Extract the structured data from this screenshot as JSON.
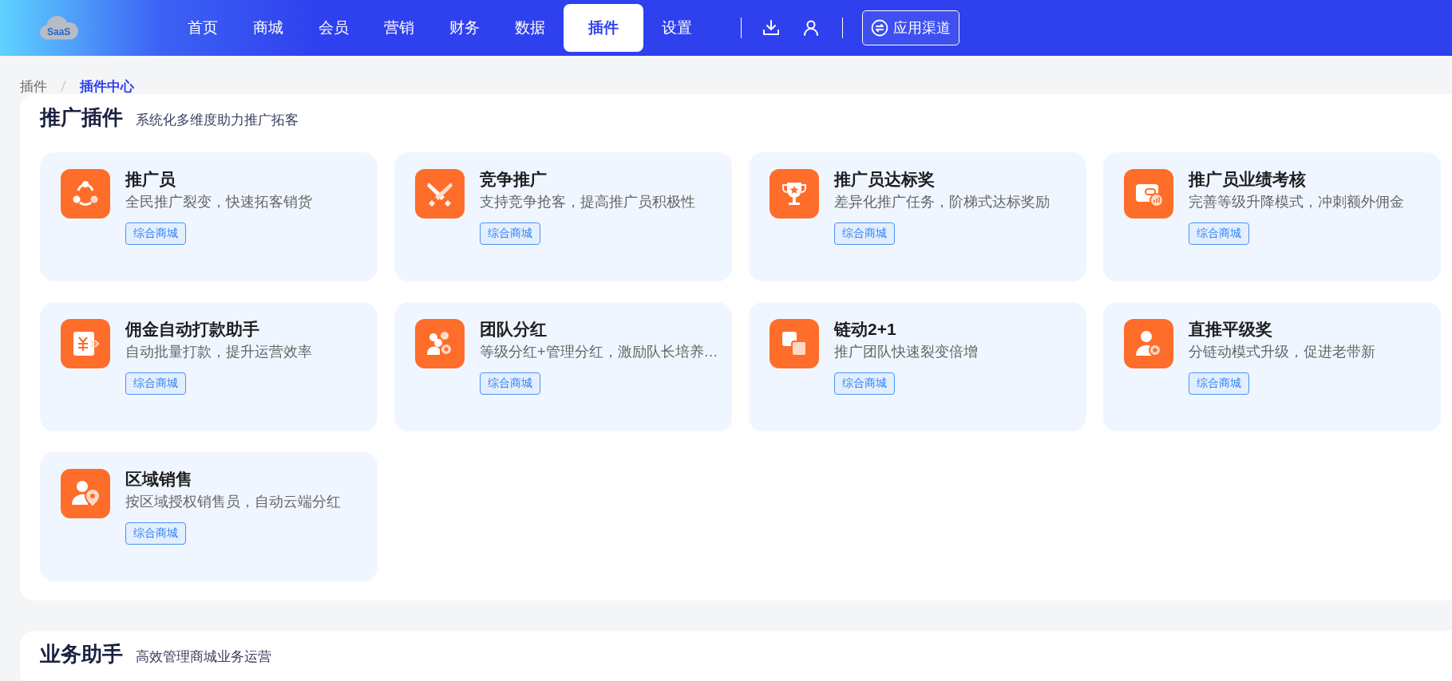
{
  "header": {
    "logo_text": "SaaS",
    "nav": [
      {
        "label": "首页",
        "selected": false
      },
      {
        "label": "商城",
        "selected": false
      },
      {
        "label": "会员",
        "selected": false
      },
      {
        "label": "营销",
        "selected": false
      },
      {
        "label": "财务",
        "selected": false
      },
      {
        "label": "数据",
        "selected": false
      },
      {
        "label": "插件",
        "selected": true
      },
      {
        "label": "设置",
        "selected": false
      }
    ],
    "channel_button": "应用渠道"
  },
  "breadcrumb": [
    {
      "label": "插件",
      "selected": false
    },
    {
      "label": "插件中心",
      "selected": true
    }
  ],
  "sections": [
    {
      "title": "推广插件",
      "subtitle": "系统化多维度助力推广拓客",
      "plugins": [
        {
          "name": "推广员",
          "description": "全民推广裂变，快速拓客销货",
          "tag": "综合商城"
        },
        {
          "name": "竞争推广",
          "description": "支持竞争抢客，提高推广员积极性",
          "tag": "综合商城"
        },
        {
          "name": "推广员达标奖",
          "description": "差异化推广任务，阶梯式达标奖励",
          "tag": "综合商城"
        },
        {
          "name": "推广员业绩考核",
          "description": "完善等级升降模式，冲刺额外佣金",
          "tag": "综合商城"
        },
        {
          "name": "佣金自动打款助手",
          "description": "自动批量打款，提升运营效率",
          "tag": "综合商城"
        },
        {
          "name": "团队分红",
          "description": "等级分红+管理分红，激励队长培养…",
          "tag": "综合商城"
        },
        {
          "name": "链动2+1",
          "description": "推广团队快速裂变倍增",
          "tag": "综合商城"
        },
        {
          "name": "直推平级奖",
          "description": "分链动模式升级，促进老带新",
          "tag": "综合商城"
        },
        {
          "name": "区域销售",
          "description": "按区域授权销售员，自动云端分红",
          "tag": "综合商城"
        }
      ]
    },
    {
      "title": "业务助手",
      "subtitle": "高效管理商城业务运营"
    }
  ]
}
